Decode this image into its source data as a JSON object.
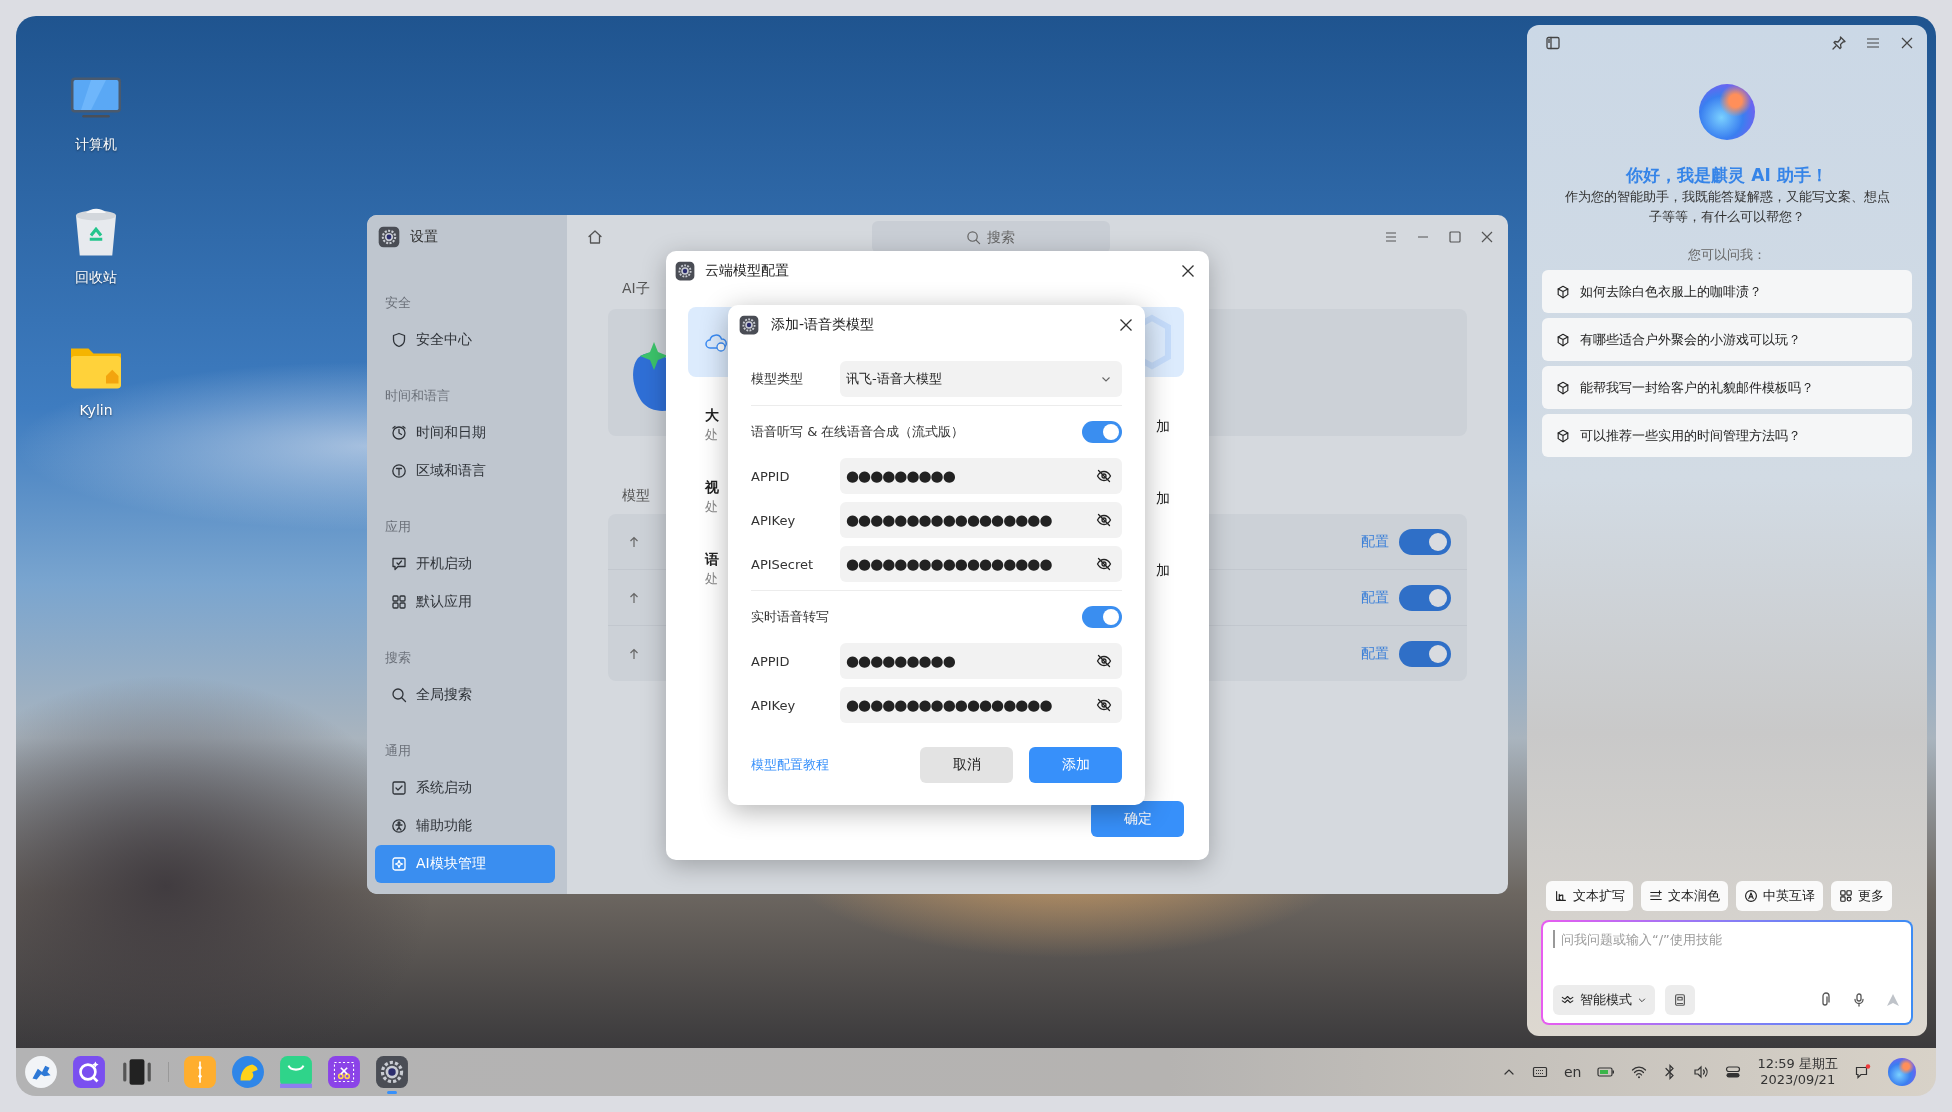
{
  "desktop": {
    "icons": [
      {
        "kind": "computer",
        "label": "计算机"
      },
      {
        "kind": "trash",
        "label": "回收站"
      },
      {
        "kind": "folder",
        "label": "Kylin"
      }
    ]
  },
  "settings_window": {
    "title": "设置",
    "search": {
      "placeholder": "搜索"
    },
    "sidebar": [
      {
        "heading": "安全",
        "items": [
          {
            "label": "安全中心",
            "selected": false
          }
        ]
      },
      {
        "heading": "时间和语言",
        "items": [
          {
            "label": "时间和日期",
            "selected": false
          },
          {
            "label": "区域和语言",
            "selected": false
          }
        ]
      },
      {
        "heading": "应用",
        "items": [
          {
            "label": "开机启动",
            "selected": false
          },
          {
            "label": "默认应用",
            "selected": false
          }
        ]
      },
      {
        "heading": "搜索",
        "items": [
          {
            "label": "全局搜索",
            "selected": false
          }
        ]
      },
      {
        "heading": "通用",
        "items": [
          {
            "label": "系统启动",
            "selected": false
          },
          {
            "label": "辅助功能",
            "selected": false
          },
          {
            "label": "AI模块管理",
            "selected": true
          }
        ]
      }
    ],
    "content": {
      "heading_1": "AI子",
      "heading_2": "模型",
      "rows": [
        {
          "link": "配置",
          "on": true
        },
        {
          "link": "配置",
          "on": true
        },
        {
          "link": "配置",
          "on": true
        }
      ]
    }
  },
  "cloud_dialog": {
    "title": "云端模型配置",
    "categories": [
      {
        "title": "大",
        "desc": "处",
        "action": "加"
      },
      {
        "title": "视",
        "desc": "处",
        "action": "加"
      },
      {
        "title": "语",
        "desc": "处",
        "action": "加"
      }
    ],
    "confirm": "确定"
  },
  "add_dialog": {
    "title": "添加-语音类模型",
    "model_type": {
      "label": "模型类型",
      "value": "讯飞-语音大模型"
    },
    "sections": [
      {
        "label": "语音听写 & 在线语音合成（流式版）",
        "on": true,
        "fields": [
          {
            "label": "APPID",
            "value": "●●●●●●●●●"
          },
          {
            "label": "APIKey",
            "value": "●●●●●●●●●●●●●●●●●"
          },
          {
            "label": "APISecret",
            "value": "●●●●●●●●●●●●●●●●●"
          }
        ]
      },
      {
        "label": "实时语音转写",
        "on": true,
        "fields": [
          {
            "label": "APPID",
            "value": "●●●●●●●●●"
          },
          {
            "label": "APIKey",
            "value": "●●●●●●●●●●●●●●●●●"
          }
        ]
      }
    ],
    "tutorial_link": "模型配置教程",
    "buttons": [
      {
        "kind": "secondary",
        "label": "取消"
      },
      {
        "kind": "primary",
        "label": "添加"
      }
    ]
  },
  "assistant": {
    "greeting": "你好，我是麒灵 AI 助手！",
    "intro": "作为您的智能助手，我既能答疑解惑，又能写文案、想点子等等，有什么可以帮您？",
    "prompt_heading": "您可以问我：",
    "suggestions": [
      "如何去除白色衣服上的咖啡渍？",
      "有哪些适合户外聚会的小游戏可以玩？",
      "能帮我写一封给客户的礼貌邮件模板吗？",
      "可以推荐一些实用的时间管理方法吗？"
    ],
    "tools": [
      "文本扩写",
      "文本润色",
      "中英互译",
      "更多"
    ],
    "input": {
      "placeholder": "问我问题或输入“/”使用技能"
    },
    "mode": "智能模式"
  },
  "taskbar": {
    "apps": [
      {
        "kind": "start",
        "selected": false
      },
      {
        "kind": "search",
        "selected": false
      },
      {
        "kind": "multitask",
        "selected": false
      },
      {
        "kind": "separator"
      },
      {
        "kind": "mail",
        "selected": false
      },
      {
        "kind": "browser",
        "selected": false
      },
      {
        "kind": "store",
        "selected": false
      },
      {
        "kind": "screenshot",
        "selected": false
      },
      {
        "kind": "settings",
        "selected": true
      }
    ],
    "tray": {
      "language": "en",
      "time": "12:59 星期五",
      "date": "2023/09/21"
    }
  }
}
